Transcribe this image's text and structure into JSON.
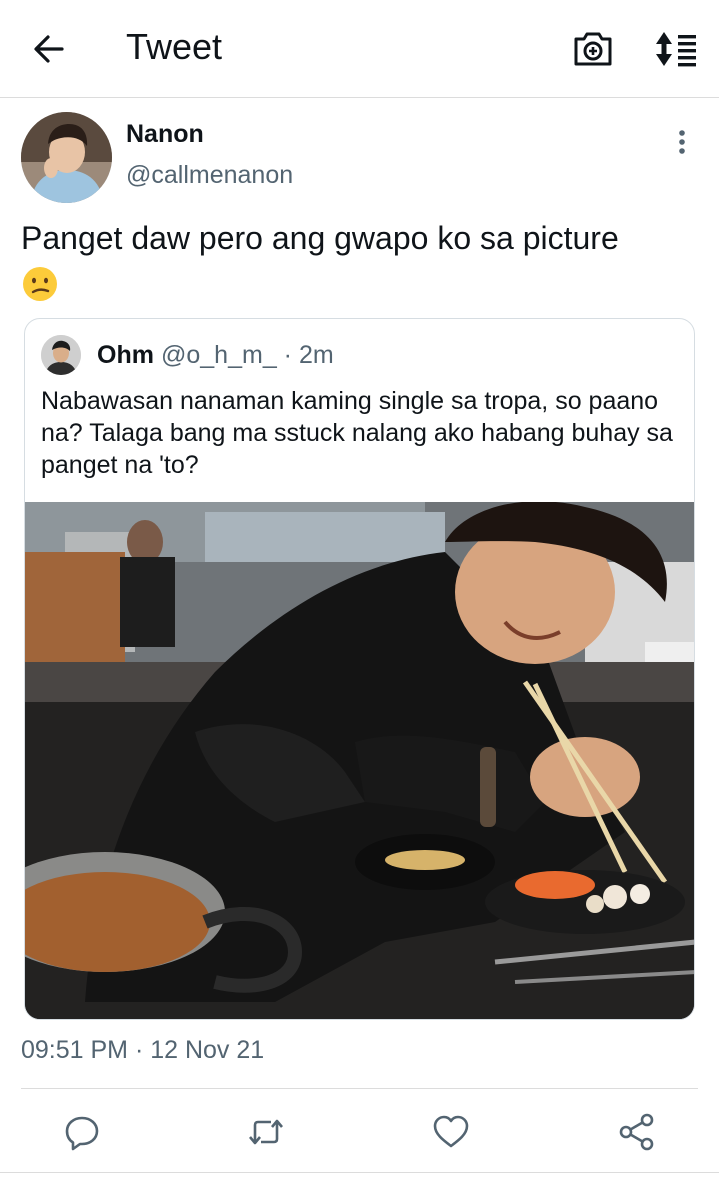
{
  "header": {
    "title": "Tweet",
    "back_icon": "arrow-left-icon",
    "camera_icon": "camera-plus-icon",
    "sort_icon": "sort-list-icon"
  },
  "tweet": {
    "author_name": "Nanon",
    "author_handle": "@callmenanon",
    "text": "Panget daw pero ang gwapo ko sa picture",
    "emoji": "confused-face-emoji",
    "timestamp": "09:51 PM · 12 Nov 21"
  },
  "quoted": {
    "name": "Ohm",
    "handle_time": "@o_h_m_ · 2m",
    "text": "Nabawasan nanaman kaming single sa tropa, so paano na? Talaga bang ma sstuck nalang ako habang buhay sa panget na 'to?"
  },
  "actions": {
    "reply_icon": "reply-icon",
    "retweet_icon": "retweet-icon",
    "like_icon": "heart-icon",
    "share_icon": "share-icon"
  },
  "colors": {
    "text_primary": "#0f1419",
    "text_secondary": "#536471",
    "border": "#dcdcdc"
  }
}
